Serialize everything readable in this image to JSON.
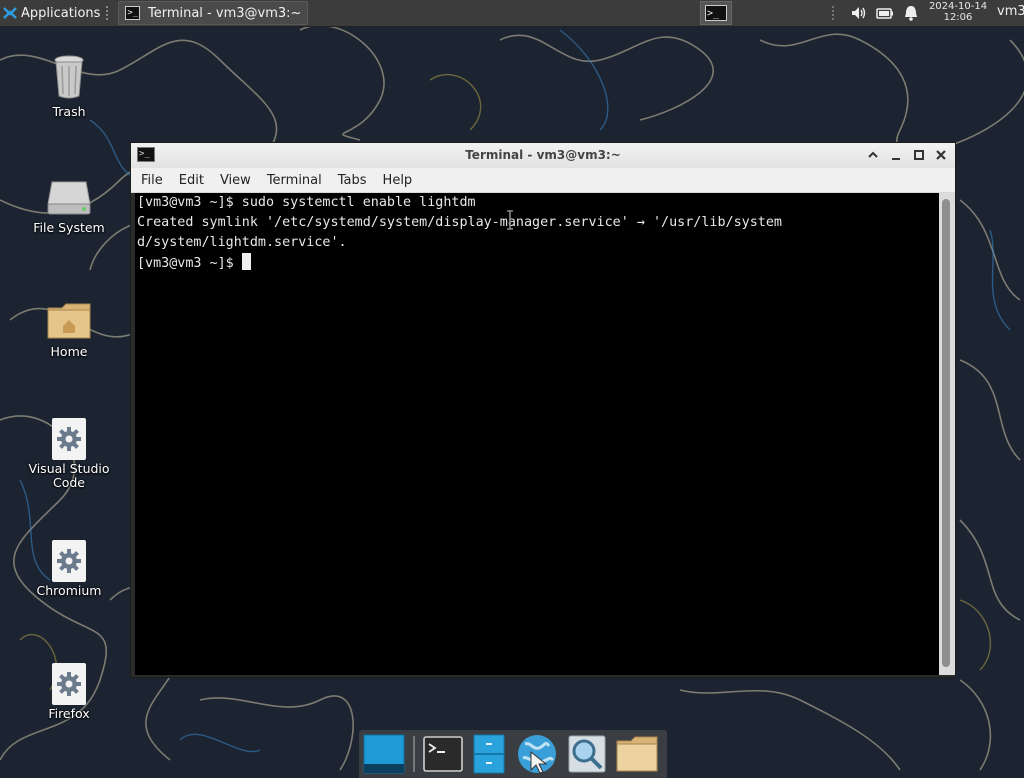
{
  "top_panel": {
    "apps_label": "Applications",
    "task_title": "Terminal - vm3@vm3:~",
    "clock_date": "2024-10-14",
    "clock_time": "12:06",
    "user": "vm3",
    "tray_icons": [
      "volume-icon",
      "battery-icon",
      "notification-bell-icon"
    ]
  },
  "desktop_icons": [
    {
      "label": "Trash",
      "icon": "trash-icon"
    },
    {
      "label": "File System",
      "icon": "drive-icon"
    },
    {
      "label": "Home",
      "icon": "home-folder-icon"
    },
    {
      "label": "Visual Studio Code",
      "icon": "gear-icon"
    },
    {
      "label": "Chromium",
      "icon": "gear-icon"
    },
    {
      "label": "Firefox",
      "icon": "gear-icon"
    }
  ],
  "window": {
    "title": "Terminal - vm3@vm3:~",
    "menu": [
      "File",
      "Edit",
      "View",
      "Terminal",
      "Tabs",
      "Help"
    ],
    "lines": [
      "[vm3@vm3 ~]$ sudo systemctl enable lightdm",
      "Created symlink '/etc/systemd/system/display-manager.service' → '/usr/lib/system",
      "d/system/lightdm.service'."
    ],
    "prompt": "[vm3@vm3 ~]$ "
  },
  "dock": {
    "items": [
      "show-desktop-icon",
      "terminal-icon",
      "file-manager-icon",
      "web-browser-icon",
      "app-finder-icon",
      "folder-icon"
    ]
  },
  "colors": {
    "panel_bg": "#3c3c3c",
    "terminal_bg": "#000000",
    "terminal_fg": "#e8e8e8",
    "accent_blue": "#1e9bd7"
  }
}
